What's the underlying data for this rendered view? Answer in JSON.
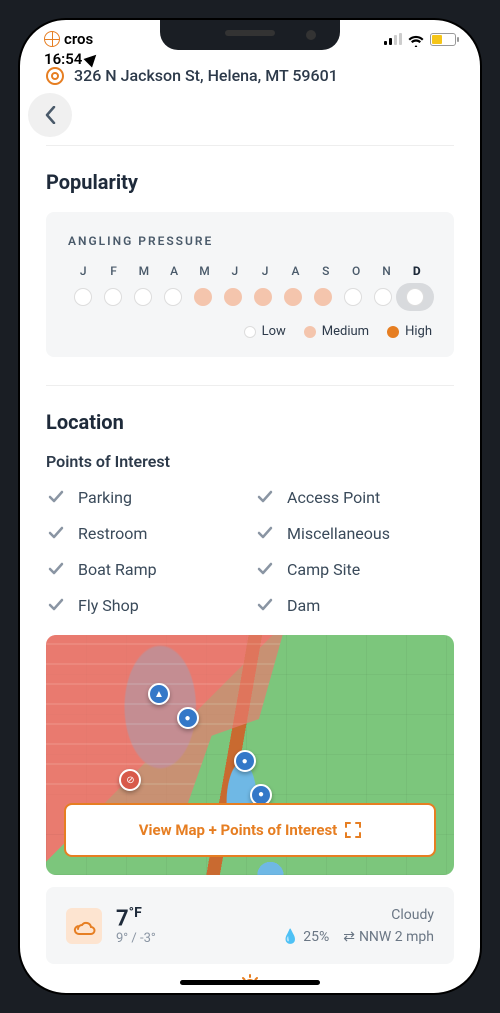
{
  "status": {
    "app_hint": "cros",
    "time": "16:54",
    "battery_color": "#f5c518"
  },
  "header": {
    "address": "326 N Jackson St, Helena, MT 59601"
  },
  "popularity": {
    "title": "Popularity",
    "pressure_label": "ANGLING PRESSURE",
    "months": [
      "J",
      "F",
      "M",
      "A",
      "M",
      "J",
      "J",
      "A",
      "S",
      "O",
      "N",
      "D"
    ],
    "levels": [
      "low",
      "low",
      "low",
      "low",
      "med",
      "med",
      "med",
      "med",
      "med",
      "low",
      "low",
      "low"
    ],
    "active_index": 11,
    "legend": {
      "low": "Low",
      "medium": "Medium",
      "high": "High"
    }
  },
  "location": {
    "title": "Location",
    "poi_title": "Points of Interest",
    "points": [
      "Parking",
      "Access Point",
      "Restroom",
      "Miscellaneous",
      "Boat Ramp",
      "Camp Site",
      "Fly Shop",
      "Dam"
    ],
    "map_button": "View Map + Points of Interest"
  },
  "weather": {
    "temp": "7",
    "unit": "°F",
    "high": "9°",
    "low": "-3°",
    "condition": "Cloudy",
    "humidity": "25%",
    "wind": "NNW 2 mph"
  }
}
